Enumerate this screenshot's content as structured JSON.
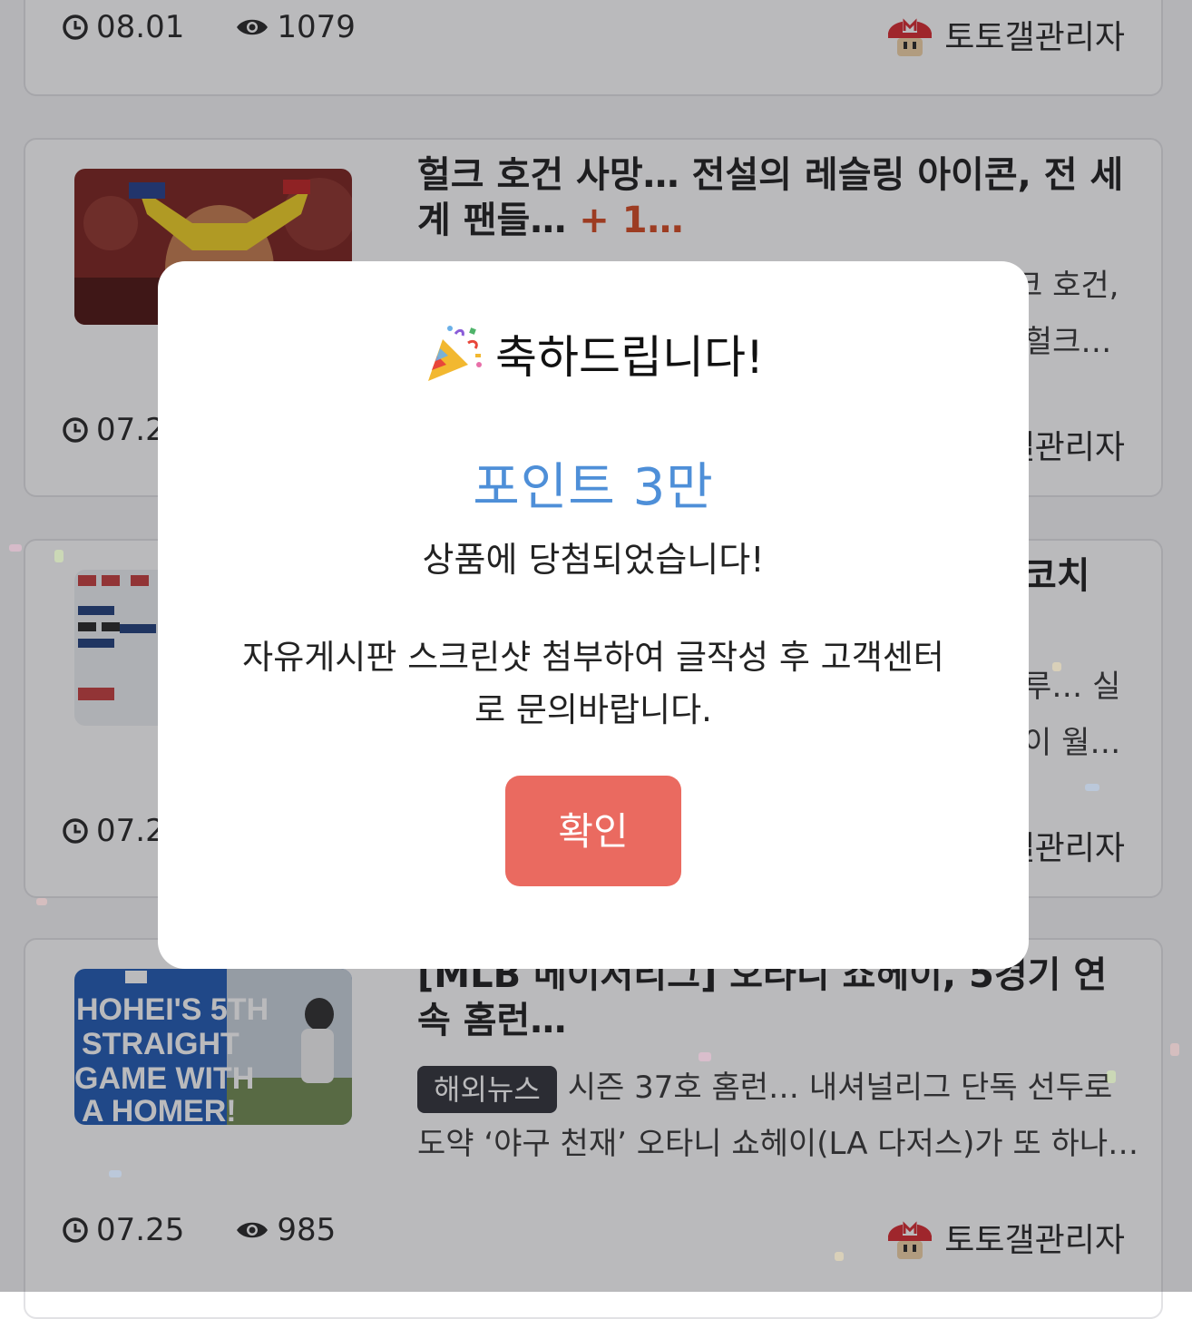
{
  "cards": [
    {
      "date": "08.01",
      "views": "1079",
      "author": "토토갤관리자"
    },
    {
      "title": "헐크 호건 사망… 전설의 레슬링 아이콘, 전 세계 팬들…",
      "plus": "+ 1…",
      "excerpt_visible_1": "크 호건,",
      "excerpt_visible_2": "‘헐크…",
      "date": "07.2",
      "author": "갤관리자"
    },
    {
      "title_visible": "코치",
      "excerpt_visible_1": "루… 실",
      "excerpt_visible_2": "이 월…",
      "date": "07.2",
      "author": "갤관리자"
    },
    {
      "title": "[MLB 메이저리그] 오타니 쇼헤이, 5경기 연속 홈런…",
      "tag": "해외뉴스",
      "excerpt": "시즌 37호 홈런… 내셔널리그 단독 선두로 도약 ‘야구 천재’ 오타니 쇼헤이(LA 다저스)가 또 하나…",
      "image_text": "HOHEI'S 5TH STRAIGHT GAME WITH A HOMER!",
      "date": "07.25",
      "views": "985",
      "author": "토토갤관리자"
    }
  ],
  "modal": {
    "heading": "축하드립니다!",
    "heading_icon": "party-popper-icon",
    "prize": "포인트 3만",
    "message1": "상품에 당첨되었습니다!",
    "message2": "자유게시판 스크린샷 첨부하여 글작성 후 고객센터로 문의바랍니다.",
    "confirm_label": "확인"
  },
  "colors": {
    "accent_blue": "#4e8fd8",
    "button_red": "#ea6a60",
    "tag_bg": "#2d2f36",
    "plus_orange": "#d4461c"
  }
}
